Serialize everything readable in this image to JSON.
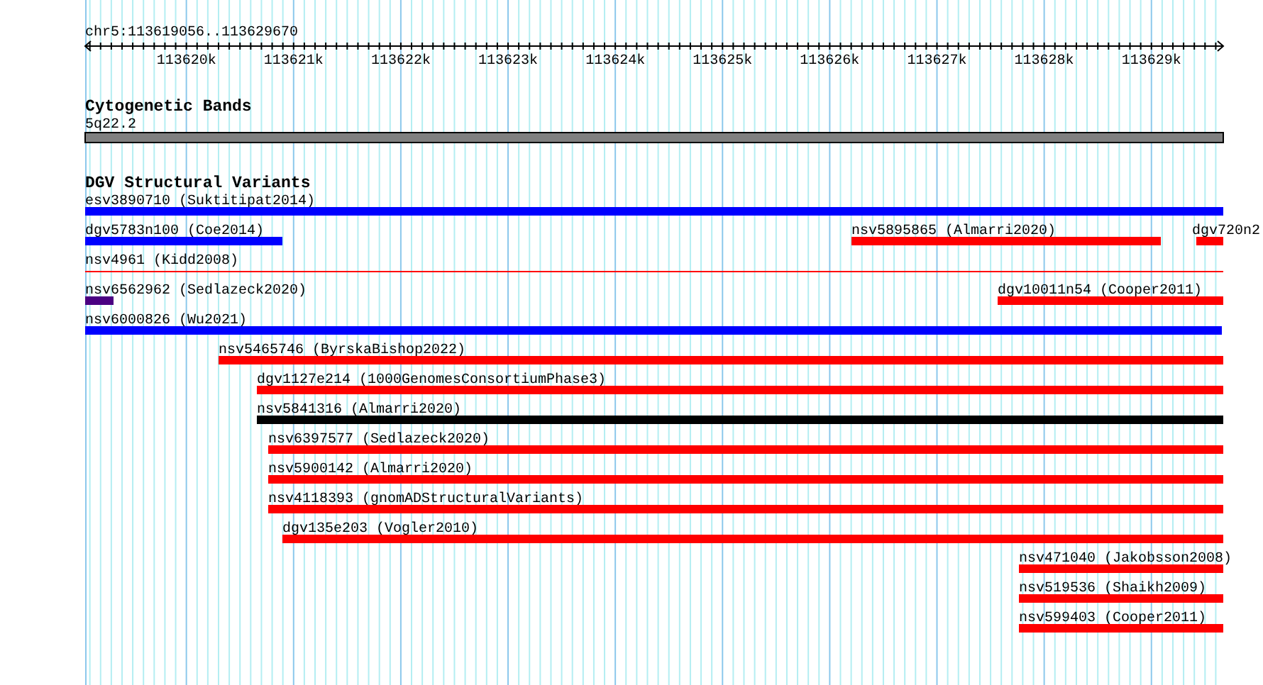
{
  "view": {
    "position_label": "chr5:113619056..113629670"
  },
  "ruler": {
    "ticks": [
      {
        "label": "113620k"
      },
      {
        "label": "113621k"
      },
      {
        "label": "113622k"
      },
      {
        "label": "113623k"
      },
      {
        "label": "113624k"
      },
      {
        "label": "113625k"
      },
      {
        "label": "113626k"
      },
      {
        "label": "113627k"
      },
      {
        "label": "113628k"
      },
      {
        "label": "113629k"
      }
    ]
  },
  "cytoband_track": {
    "title": "Cytogenetic Bands",
    "bands": [
      {
        "name": "5q22.2"
      }
    ]
  },
  "variant_track": {
    "title": "DGV Structural Variants",
    "rows": [
      [
        {
          "label": "esv3890710 (Suktitipat2014)",
          "color": "#0000ff",
          "kind": "bar"
        }
      ],
      [
        {
          "label": "dgv5783n100 (Coe2014)",
          "color": "#0000ff",
          "kind": "bar"
        },
        {
          "label": "nsv5895865 (Almarri2020)",
          "color": "#ff0000",
          "kind": "bar"
        },
        {
          "label": "dgv720n2",
          "color": "#ff0000",
          "kind": "bar"
        }
      ],
      [
        {
          "label": "nsv4961 (Kidd2008)",
          "color": "#ff0000",
          "kind": "line"
        }
      ],
      [
        {
          "label": "nsv6562962 (Sedlazeck2020)",
          "color": "#4b0082",
          "kind": "bar"
        },
        {
          "label": "dgv10011n54 (Cooper2011)",
          "color": "#ff0000",
          "kind": "bar"
        }
      ],
      [
        {
          "label": "nsv6000826 (Wu2021)",
          "color": "#0000ff",
          "kind": "bar"
        }
      ],
      [
        {
          "label": "nsv5465746 (ByrskaBishop2022)",
          "color": "#ff0000",
          "kind": "bar"
        }
      ],
      [
        {
          "label": "dgv1127e214 (1000GenomesConsortiumPhase3)",
          "color": "#ff0000",
          "kind": "bar"
        }
      ],
      [
        {
          "label": "nsv5841316 (Almarri2020)",
          "color": "#000000",
          "kind": "bar"
        }
      ],
      [
        {
          "label": "nsv6397577 (Sedlazeck2020)",
          "color": "#ff0000",
          "kind": "bar"
        }
      ],
      [
        {
          "label": "nsv5900142 (Almarri2020)",
          "color": "#ff0000",
          "kind": "bar"
        }
      ],
      [
        {
          "label": "nsv4118393 (gnomADStructuralVariants)",
          "color": "#ff0000",
          "kind": "bar"
        }
      ],
      [
        {
          "label": "dgv135e203 (Vogler2010)",
          "color": "#ff0000",
          "kind": "bar"
        }
      ],
      [
        {
          "label": "nsv471040 (Jakobsson2008)",
          "color": "#ff0000",
          "kind": "bar"
        }
      ],
      [
        {
          "label": "nsv519536 (Shaikh2009)",
          "color": "#ff0000",
          "kind": "bar"
        }
      ],
      [
        {
          "label": "nsv599403 (Cooper2011)",
          "color": "#ff0000",
          "kind": "bar"
        }
      ]
    ]
  }
}
